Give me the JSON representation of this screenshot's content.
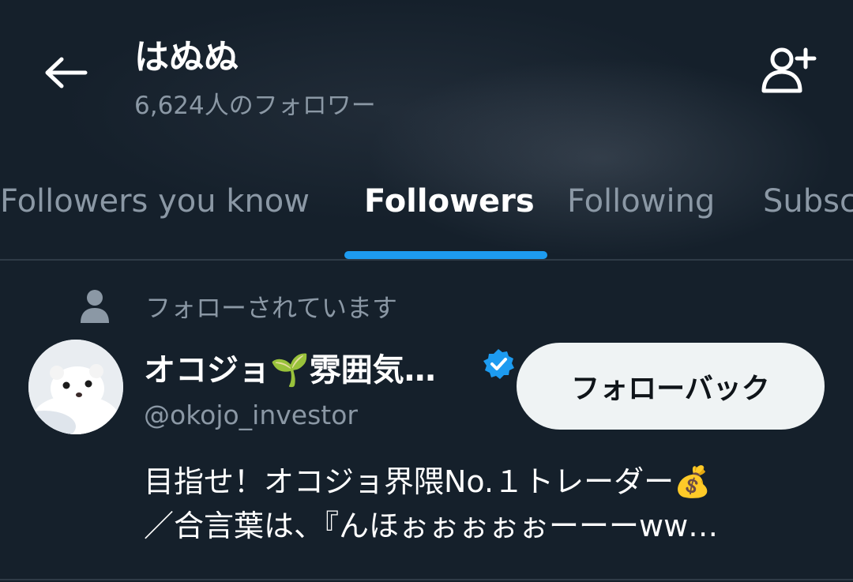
{
  "header": {
    "title": "はぬぬ",
    "subtitle": "6,624人のフォロワー"
  },
  "tabs": [
    {
      "label": "Followers you know",
      "active": false
    },
    {
      "label": "Followers",
      "active": true
    },
    {
      "label": "Following",
      "active": false
    },
    {
      "label": "Subsc",
      "active": false
    }
  ],
  "follower": {
    "follows_you_text": "フォローされています",
    "display_name": "オコジョ🌱雰囲気…",
    "verified": true,
    "handle": "@okojo_investor",
    "follow_back_label": "フォローバック",
    "bio_lines": [
      "目指せ！オコジョ界隈No.１トレーダー💰",
      "／合言葉は、『んほぉぉぉぉぉーーーww…"
    ]
  },
  "colors": {
    "background": "#15202b",
    "accent": "#1d9bf0",
    "secondary_text": "#8b98a5",
    "button_bg": "#eff3f4"
  },
  "icons": {
    "back": "back-arrow-icon",
    "add_user": "add-user-icon",
    "person": "person-icon",
    "verified": "verified-badge-icon"
  }
}
